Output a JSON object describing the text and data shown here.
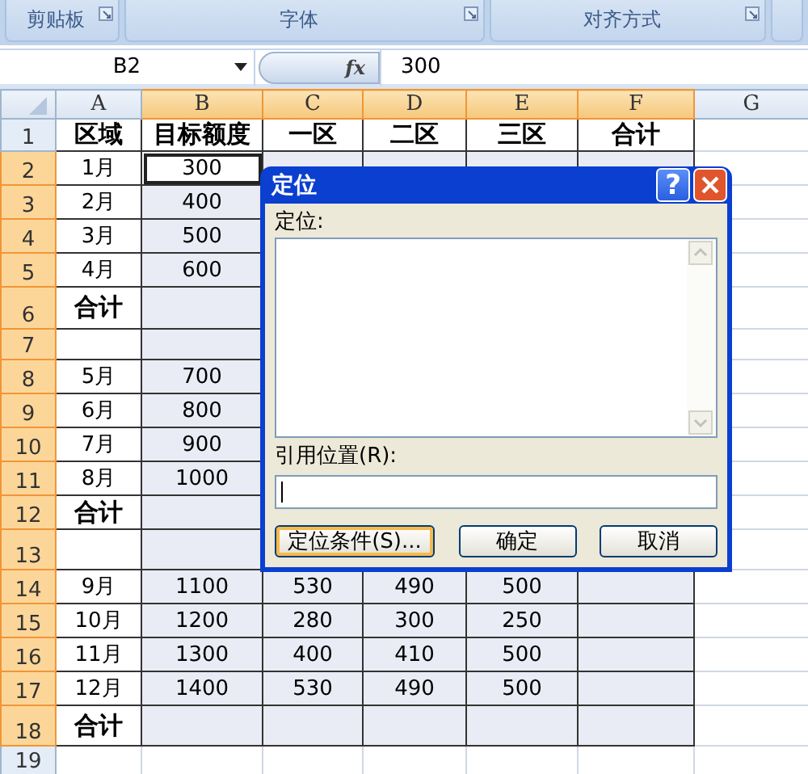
{
  "ribbon": {
    "groups": [
      {
        "label": "剪贴板"
      },
      {
        "label": "字体"
      },
      {
        "label": "对齐方式"
      }
    ]
  },
  "formula_bar": {
    "name_box": "B2",
    "fx": "fx",
    "value": "300"
  },
  "sheet": {
    "columns": [
      {
        "label": "A",
        "selected": false
      },
      {
        "label": "B",
        "selected": true
      },
      {
        "label": "C",
        "selected": true
      },
      {
        "label": "D",
        "selected": true
      },
      {
        "label": "E",
        "selected": true
      },
      {
        "label": "F",
        "selected": true
      },
      {
        "label": "G",
        "selected": false
      }
    ],
    "rows": [
      {
        "header": "1",
        "selected": false,
        "kind": "header",
        "cells": [
          "区域",
          "目标额度",
          "一区",
          "二区",
          "三区",
          "合计"
        ]
      },
      {
        "header": "2",
        "selected": true,
        "kind": "data",
        "cells": [
          "1月",
          "300",
          null,
          null,
          null,
          null
        ]
      },
      {
        "header": "3",
        "selected": true,
        "kind": "data",
        "cells": [
          "2月",
          "400",
          null,
          null,
          null,
          null
        ]
      },
      {
        "header": "4",
        "selected": true,
        "kind": "data",
        "cells": [
          "3月",
          "500",
          null,
          null,
          null,
          null
        ]
      },
      {
        "header": "5",
        "selected": true,
        "kind": "data",
        "cells": [
          "4月",
          "600",
          null,
          null,
          null,
          null
        ]
      },
      {
        "header": "6",
        "selected": true,
        "kind": "total",
        "cells": [
          "合计",
          null,
          null,
          null,
          null,
          null
        ]
      },
      {
        "header": "7",
        "selected": true,
        "kind": "data",
        "cells": [
          null,
          null,
          null,
          null,
          null,
          null
        ]
      },
      {
        "header": "8",
        "selected": true,
        "kind": "data",
        "cells": [
          "5月",
          "700",
          null,
          null,
          null,
          null
        ]
      },
      {
        "header": "9",
        "selected": true,
        "kind": "data",
        "cells": [
          "6月",
          "800",
          null,
          null,
          null,
          null
        ]
      },
      {
        "header": "10",
        "selected": true,
        "kind": "data",
        "cells": [
          "7月",
          "900",
          null,
          null,
          null,
          null
        ]
      },
      {
        "header": "11",
        "selected": true,
        "kind": "data",
        "cells": [
          "8月",
          "1000",
          null,
          null,
          null,
          null
        ]
      },
      {
        "header": "12",
        "selected": true,
        "kind": "total",
        "cells": [
          "合计",
          null,
          null,
          null,
          null,
          null
        ]
      },
      {
        "header": "13",
        "selected": true,
        "kind": "data",
        "cells": [
          null,
          null,
          null,
          null,
          null,
          null
        ]
      },
      {
        "header": "14",
        "selected": true,
        "kind": "data",
        "cells": [
          "9月",
          "1100",
          "530",
          "490",
          "500",
          null
        ]
      },
      {
        "header": "15",
        "selected": true,
        "kind": "data",
        "cells": [
          "10月",
          "1200",
          "280",
          "300",
          "250",
          null
        ]
      },
      {
        "header": "16",
        "selected": true,
        "kind": "data",
        "cells": [
          "11月",
          "1300",
          "400",
          "410",
          "500",
          null
        ]
      },
      {
        "header": "17",
        "selected": true,
        "kind": "data",
        "cells": [
          "12月",
          "1400",
          "530",
          "490",
          "500",
          null
        ]
      },
      {
        "header": "18",
        "selected": true,
        "kind": "total",
        "cells": [
          "合计",
          null,
          null,
          null,
          null,
          null
        ]
      },
      {
        "header": "19",
        "selected": false,
        "kind": "blank",
        "cells": []
      }
    ]
  },
  "dialog": {
    "title": "定位",
    "help": "?",
    "list_label": "定位:",
    "ref_label": "引用位置(R):",
    "buttons": [
      {
        "label": "定位条件(S)...",
        "focused": true
      },
      {
        "label": "确定",
        "focused": false
      },
      {
        "label": "取消",
        "focused": false
      }
    ]
  }
}
